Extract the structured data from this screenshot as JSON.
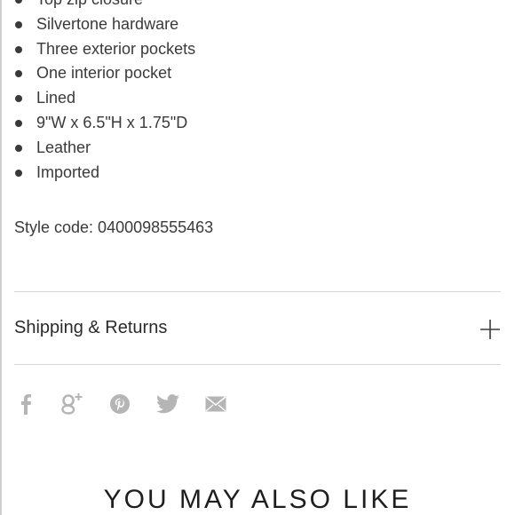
{
  "product_details": {
    "bullets": [
      "Top zip closure",
      "Silvertone hardware",
      "Three exterior pockets",
      "One interior pocket",
      "Lined",
      "9\"W x 6.5\"H x 1.75\"D",
      "Leather",
      "Imported"
    ],
    "style_code": "Style code: 0400098555463"
  },
  "accordion": {
    "shipping_returns_label": "Shipping & Returns",
    "toggle_icon": "plus-icon"
  },
  "share": {
    "icons": [
      "facebook-icon",
      "google-plus-icon",
      "pinterest-icon",
      "twitter-icon",
      "email-icon"
    ],
    "icon_color": "#b5b5b5"
  },
  "recommendations": {
    "heading": "YOU MAY ALSO LIKE"
  },
  "colors": {
    "text": "#3a3a3a",
    "divider": "#d6d6d6",
    "background": "#ffffff"
  }
}
